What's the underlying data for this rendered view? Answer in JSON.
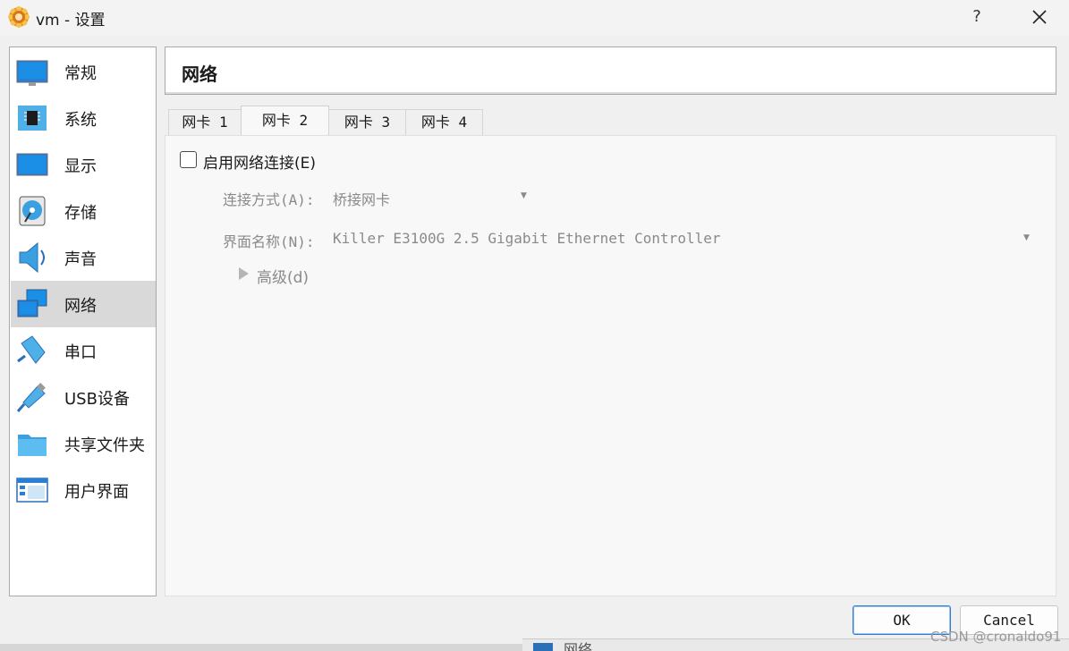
{
  "window": {
    "title": "vm - 设置",
    "help_label": "?",
    "icon": "virtualbox-gear-icon"
  },
  "sidebar": {
    "items": [
      {
        "label": "常规",
        "icon": "general-monitor-icon"
      },
      {
        "label": "系统",
        "icon": "system-chip-icon"
      },
      {
        "label": "显示",
        "icon": "display-monitor-icon"
      },
      {
        "label": "存储",
        "icon": "storage-disk-icon"
      },
      {
        "label": "声音",
        "icon": "audio-speaker-icon"
      },
      {
        "label": "网络",
        "icon": "network-icon",
        "selected": true
      },
      {
        "label": "串口",
        "icon": "serial-port-icon"
      },
      {
        "label": "USB设备",
        "icon": "usb-icon"
      },
      {
        "label": "共享文件夹",
        "icon": "shared-folder-icon"
      },
      {
        "label": "用户界面",
        "icon": "user-interface-icon"
      }
    ]
  },
  "page": {
    "title": "网络"
  },
  "tabs": [
    {
      "label": "网卡 1"
    },
    {
      "label": "网卡 2",
      "active": true
    },
    {
      "label": "网卡 3"
    },
    {
      "label": "网卡 4"
    }
  ],
  "adapter": {
    "enable_label": "启用网络连接(E)",
    "enabled": false,
    "attached_label": "连接方式(A):",
    "attached_value": "桥接网卡",
    "name_label": "界面名称(N):",
    "name_value": "Killer E3100G 2.5 Gigabit Ethernet Controller",
    "advanced_label": "高级(d)"
  },
  "buttons": {
    "ok": "OK",
    "cancel": "Cancel"
  },
  "background": {
    "fragment_text": "网络"
  },
  "watermark": "CSDN @cronaldo91",
  "colors": {
    "accent": "#2d7dd2",
    "selected_bg": "#d9d9d9",
    "disabled_text": "#8a8a8a"
  }
}
